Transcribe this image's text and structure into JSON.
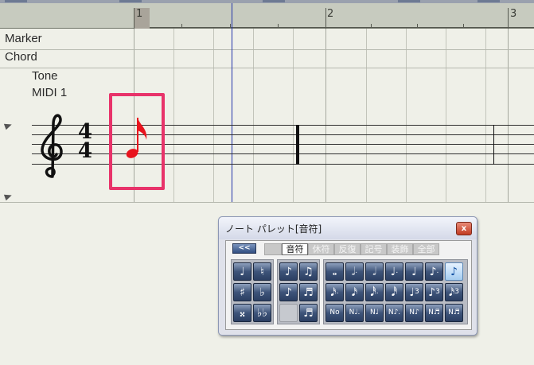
{
  "ruler": {
    "bars": [
      "1",
      "2",
      "3"
    ]
  },
  "tracks": {
    "marker_label": "Marker",
    "chord_label": "Chord",
    "instrument_name": "Tone",
    "instrument_port": "MIDI 1"
  },
  "score": {
    "time_sig_top": "4",
    "time_sig_bottom": "4",
    "selected_note": "eighth-note",
    "selection_color": "#e8336a",
    "note_color": "#e8141e"
  },
  "palette": {
    "title": "ノート パレット[音符]",
    "close_label": "x",
    "collapse_label": "<<",
    "tabs": [
      {
        "label": "音符",
        "active": true
      },
      {
        "label": "休符",
        "active": false
      },
      {
        "label": "反復",
        "active": false
      },
      {
        "label": "記号",
        "active": false
      },
      {
        "label": "装飾",
        "active": false
      },
      {
        "label": "全部",
        "active": false
      }
    ],
    "accidentals": [
      {
        "icon": "tie-icon",
        "glyph": "♩",
        "blank": false
      },
      {
        "icon": "natural-icon",
        "glyph": "♮",
        "blank": false
      },
      {
        "icon": "sharp-icon",
        "glyph": "♯",
        "blank": false
      },
      {
        "icon": "flat-icon",
        "glyph": "♭",
        "blank": false
      },
      {
        "icon": "double-sharp-icon",
        "glyph": "𝄪",
        "blank": false
      },
      {
        "icon": "double-flat-icon",
        "glyph": "♭♭",
        "blank": false
      }
    ],
    "grace": [
      {
        "icon": "grace-note-icon",
        "glyph": "♪",
        "blank": false
      },
      {
        "icon": "grace-eighth-icon",
        "glyph": "♫",
        "blank": false
      },
      {
        "icon": "grace-slash-icon",
        "glyph": "♪",
        "blank": false
      },
      {
        "icon": "grace-pair-icon",
        "glyph": "♬",
        "blank": false
      },
      {
        "icon": "empty-slot-icon",
        "glyph": "",
        "blank": true
      },
      {
        "icon": "accent-pair-icon",
        "glyph": "♬",
        "blank": false
      }
    ],
    "notes": [
      {
        "icon": "whole-note-icon",
        "glyph": "𝅝",
        "sub": "",
        "selected": false
      },
      {
        "icon": "dotted-half-note-icon",
        "glyph": "𝅗𝅥",
        "sub": ".",
        "selected": false
      },
      {
        "icon": "half-note-icon",
        "glyph": "𝅗𝅥",
        "sub": "",
        "selected": false
      },
      {
        "icon": "dotted-quarter-note-icon",
        "glyph": "♩",
        "sub": ".",
        "selected": false
      },
      {
        "icon": "quarter-note-icon",
        "glyph": "♩",
        "sub": "",
        "selected": false
      },
      {
        "icon": "dotted-eighth-note-icon",
        "glyph": "♪",
        "sub": ".",
        "selected": false
      },
      {
        "icon": "eighth-note-icon",
        "glyph": "♪",
        "sub": "",
        "selected": true
      },
      {
        "icon": "dotted-sixteenth-note-icon",
        "glyph": "𝅘𝅥𝅯",
        "sub": ".",
        "selected": false
      },
      {
        "icon": "sixteenth-note-icon",
        "glyph": "𝅘𝅥𝅯",
        "sub": "",
        "selected": false
      },
      {
        "icon": "dotted-thirtysecond-note-icon",
        "glyph": "𝅘𝅥𝅰",
        "sub": ".",
        "selected": false
      },
      {
        "icon": "thirtysecond-note-icon",
        "glyph": "𝅘𝅥𝅰",
        "sub": "",
        "selected": false
      },
      {
        "icon": "triplet-quarter-icon",
        "glyph": "♩",
        "sub": "3",
        "selected": false
      },
      {
        "icon": "triplet-eighth-icon",
        "glyph": "♪",
        "sub": "3",
        "selected": false
      },
      {
        "icon": "triplet-sixteenth-icon",
        "glyph": "𝅘𝅥𝅯",
        "sub": "3",
        "selected": false
      },
      {
        "icon": "n-whole-note-icon",
        "glyph": "N",
        "sub": "o",
        "selected": false
      },
      {
        "icon": "n-dotted-half-icon",
        "glyph": "N",
        "sub": "♩.",
        "selected": false
      },
      {
        "icon": "n-half-icon",
        "glyph": "N",
        "sub": "♩",
        "selected": false
      },
      {
        "icon": "n-dotted-quarter-icon",
        "glyph": "N",
        "sub": "♪.",
        "selected": false
      },
      {
        "icon": "n-quarter-icon",
        "glyph": "N",
        "sub": "♪",
        "selected": false
      },
      {
        "icon": "n-eighth-icon",
        "glyph": "N",
        "sub": "♬",
        "selected": false
      },
      {
        "icon": "n-sixteenth-icon",
        "glyph": "N",
        "sub": "♬",
        "selected": false
      }
    ]
  }
}
